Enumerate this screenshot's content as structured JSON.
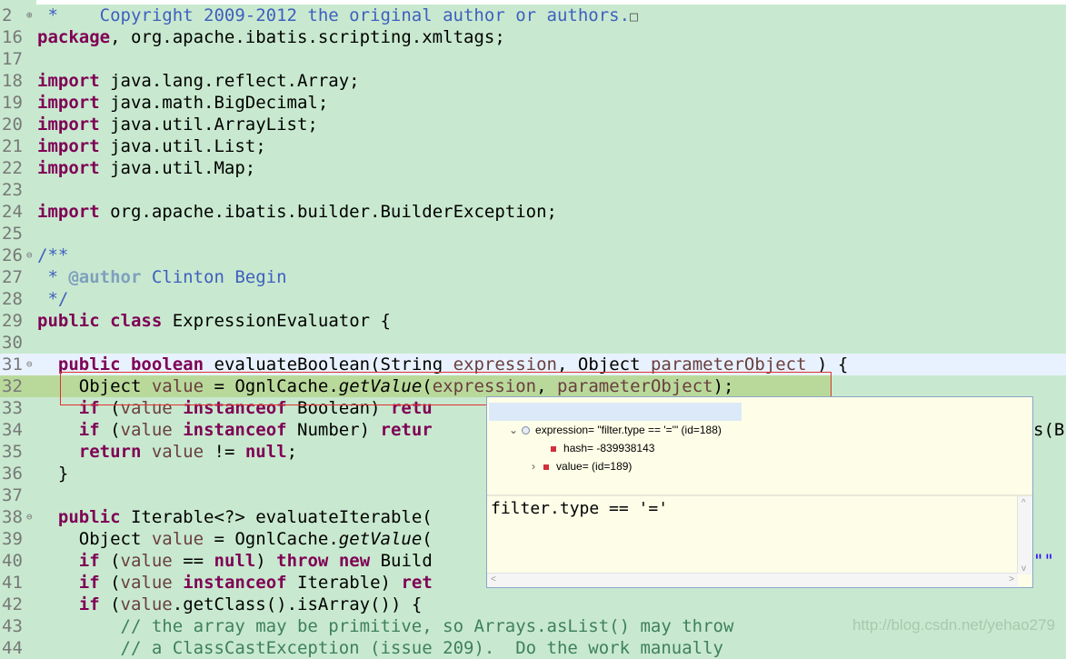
{
  "editor": {
    "lines": [
      {
        "num": "2",
        "fold": "⊕",
        "segs": [
          [
            "cm",
            " *    Copyright 2009-2012 the original author or authors."
          ],
          [
            "box",
            ""
          ]
        ]
      },
      {
        "num": "16",
        "segs": [
          [
            "kw",
            "package"
          ],
          [
            "",
            ", org.apache.ibatis.scripting.xmltags;"
          ]
        ]
      },
      {
        "num": "17",
        "segs": []
      },
      {
        "num": "18",
        "segs": [
          [
            "kw",
            "import"
          ],
          [
            "",
            " java.lang.reflect.Array;"
          ]
        ]
      },
      {
        "num": "19",
        "segs": [
          [
            "kw",
            "import"
          ],
          [
            "",
            " java.math.BigDecimal;"
          ]
        ]
      },
      {
        "num": "20",
        "segs": [
          [
            "kw",
            "import"
          ],
          [
            "",
            " java.util.ArrayList;"
          ]
        ]
      },
      {
        "num": "21",
        "segs": [
          [
            "kw",
            "import"
          ],
          [
            "",
            " java.util.List;"
          ]
        ]
      },
      {
        "num": "22",
        "segs": [
          [
            "kw",
            "import"
          ],
          [
            "",
            " java.util.Map;"
          ]
        ]
      },
      {
        "num": "23",
        "segs": []
      },
      {
        "num": "24",
        "segs": [
          [
            "kw",
            "import"
          ],
          [
            "",
            " org.apache.ibatis.builder.BuilderException;"
          ]
        ]
      },
      {
        "num": "25",
        "segs": []
      },
      {
        "num": "26",
        "fold": "⊖",
        "segs": [
          [
            "cm",
            "/**"
          ]
        ]
      },
      {
        "num": "27",
        "segs": [
          [
            "cm",
            " * "
          ],
          [
            "ann",
            "@author"
          ],
          [
            "cm",
            " Clinton Begin"
          ]
        ]
      },
      {
        "num": "28",
        "segs": [
          [
            "cm",
            " */"
          ]
        ]
      },
      {
        "num": "29",
        "segs": [
          [
            "kw",
            "public"
          ],
          [
            "",
            " "
          ],
          [
            "kw",
            "class"
          ],
          [
            "",
            " ExpressionEvaluator {"
          ]
        ]
      },
      {
        "num": "30",
        "segs": []
      },
      {
        "num": "31",
        "fold": "⊖",
        "segs": [
          [
            "",
            "  "
          ],
          [
            "kw",
            "public"
          ],
          [
            "",
            " "
          ],
          [
            "kw",
            "boolean"
          ],
          [
            "",
            " evaluateBoolean(String "
          ],
          [
            "var",
            "expression"
          ],
          [
            "",
            ", Object "
          ],
          [
            "var",
            "parameterObject"
          ],
          [
            "",
            " ) {"
          ]
        ]
      },
      {
        "num": "32",
        "segs": [
          [
            "",
            "    Object "
          ],
          [
            "var",
            "value"
          ],
          [
            "",
            " = OgnlCache."
          ],
          [
            "it",
            "getValue"
          ],
          [
            "",
            "("
          ],
          [
            "var",
            "expression"
          ],
          [
            "",
            ", "
          ],
          [
            "var",
            "parameterObject"
          ],
          [
            "",
            ");"
          ]
        ]
      },
      {
        "num": "33",
        "segs": [
          [
            "",
            "    "
          ],
          [
            "kw",
            "if"
          ],
          [
            "",
            " ("
          ],
          [
            "var",
            "value"
          ],
          [
            "",
            " "
          ],
          [
            "kw",
            "instanceof"
          ],
          [
            "",
            " Boolean) "
          ],
          [
            "kw",
            "retu"
          ]
        ]
      },
      {
        "num": "34",
        "segs": [
          [
            "",
            "    "
          ],
          [
            "kw",
            "if"
          ],
          [
            "",
            " ("
          ],
          [
            "var",
            "value"
          ],
          [
            "",
            " "
          ],
          [
            "kw",
            "instanceof"
          ],
          [
            "",
            " Number) "
          ],
          [
            "kw",
            "retur"
          ]
        ]
      },
      {
        "num": "35",
        "segs": [
          [
            "",
            "    "
          ],
          [
            "kw",
            "return"
          ],
          [
            "",
            " "
          ],
          [
            "var",
            "value"
          ],
          [
            "",
            " != "
          ],
          [
            "kw",
            "null"
          ],
          [
            "",
            ";"
          ]
        ]
      },
      {
        "num": "36",
        "segs": [
          [
            "",
            "  }"
          ]
        ]
      },
      {
        "num": "37",
        "segs": []
      },
      {
        "num": "38",
        "fold": "⊖",
        "segs": [
          [
            "",
            "  "
          ],
          [
            "kw",
            "public"
          ],
          [
            "",
            " Iterable<?> evaluateIterable("
          ]
        ]
      },
      {
        "num": "39",
        "segs": [
          [
            "",
            "    Object "
          ],
          [
            "var",
            "value"
          ],
          [
            "",
            " = OgnlCache."
          ],
          [
            "it",
            "getValue"
          ],
          [
            "",
            "("
          ]
        ]
      },
      {
        "num": "40",
        "segs": [
          [
            "",
            "    "
          ],
          [
            "kw",
            "if"
          ],
          [
            "",
            " ("
          ],
          [
            "var",
            "value"
          ],
          [
            "",
            " == "
          ],
          [
            "kw",
            "null"
          ],
          [
            "",
            ") "
          ],
          [
            "kw",
            "throw"
          ],
          [
            "",
            " "
          ],
          [
            "kw",
            "new"
          ],
          [
            "",
            " Build"
          ]
        ]
      },
      {
        "num": "41",
        "segs": [
          [
            "",
            "    "
          ],
          [
            "kw",
            "if"
          ],
          [
            "",
            " ("
          ],
          [
            "var",
            "value"
          ],
          [
            "",
            " "
          ],
          [
            "kw",
            "instanceof"
          ],
          [
            "",
            " Iterable) "
          ],
          [
            "kw",
            "ret"
          ]
        ]
      },
      {
        "num": "42",
        "segs": [
          [
            "",
            "    "
          ],
          [
            "kw",
            "if"
          ],
          [
            "",
            " ("
          ],
          [
            "var",
            "value"
          ],
          [
            "",
            ".getClass().isArray()) {"
          ]
        ]
      },
      {
        "num": "43",
        "segs": [
          [
            "",
            "        "
          ],
          [
            "lc",
            "// the array may be primitive, so Arrays.asList() may throw"
          ]
        ]
      },
      {
        "num": "44",
        "segs": [
          [
            "",
            "        "
          ],
          [
            "lc",
            "// a ClassCastException (issue 209).  Do the work manually"
          ]
        ]
      }
    ],
    "right_fragment_34": "s(B",
    "right_fragment_40": "\"\""
  },
  "popup": {
    "tree_rows": [
      {
        "label": "expression= \"filter.type == '='\" (id=188)",
        "expanded": true
      },
      {
        "label": "hash= -839938143"
      },
      {
        "label": "value= (id=189)"
      }
    ],
    "detail_text": "filter.type == '='"
  },
  "watermark": "http://blog.csdn.net/yehao279"
}
